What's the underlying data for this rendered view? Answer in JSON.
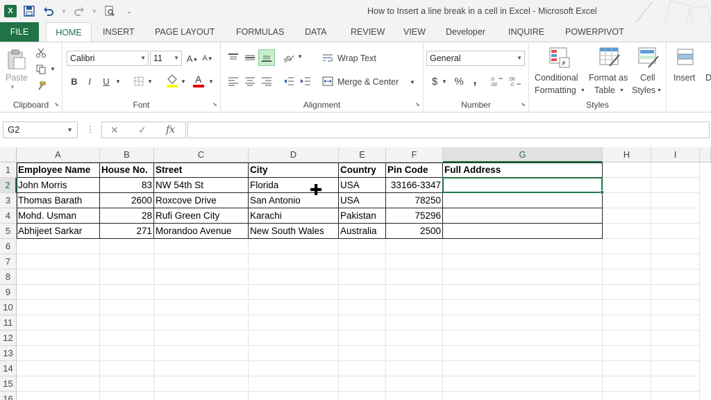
{
  "window": {
    "title": "How to Insert a line break in a cell in Excel - Microsoft Excel",
    "app_icon": "X"
  },
  "qat": {
    "icons": [
      "excel-icon",
      "save-icon",
      "undo-icon",
      "redo-icon",
      "print-preview-icon",
      "customize-icon"
    ]
  },
  "tabs": [
    "FILE",
    "HOME",
    "INSERT",
    "PAGE LAYOUT",
    "FORMULAS",
    "DATA",
    "REVIEW",
    "VIEW",
    "Developer",
    "INQUIRE",
    "POWERPIVOT"
  ],
  "ribbon": {
    "clipboard": {
      "label": "Clipboard",
      "paste": "Paste"
    },
    "font": {
      "label": "Font",
      "name": "Calibri",
      "size": "11",
      "bold": "B",
      "italic": "I",
      "underline": "U"
    },
    "alignment": {
      "label": "Alignment",
      "wrap_text": "Wrap Text",
      "merge_center": "Merge & Center"
    },
    "number": {
      "label": "Number",
      "format": "General",
      "currency": "$",
      "percent": "%",
      "comma": ","
    },
    "styles": {
      "label": "Styles",
      "conditional": "Conditional",
      "conditional2": "Formatting",
      "format_as": "Format as",
      "format_as2": "Table",
      "cell": "Cell",
      "cell2": "Styles"
    },
    "cells": {
      "insert": "Insert",
      "delete": "D"
    }
  },
  "formula_bar": {
    "name_box": "G2",
    "cancel": "✕",
    "enter": "✓",
    "fx": "fx",
    "content": ""
  },
  "sheet": {
    "columns": [
      "A",
      "B",
      "C",
      "D",
      "E",
      "F",
      "G",
      "H",
      "I"
    ],
    "rows": [
      "1",
      "2",
      "3",
      "4",
      "5",
      "6",
      "7",
      "8",
      "9",
      "10",
      "11",
      "12",
      "13",
      "14",
      "15",
      "16"
    ],
    "headers": [
      "Employee Name",
      "House No.",
      "Street",
      "City",
      "Country",
      "Pin Code",
      "Full Address"
    ],
    "data": [
      [
        "John Morris",
        "83",
        "NW 54th St",
        "Florida",
        "USA",
        "33166-3347",
        ""
      ],
      [
        "Thomas Barath",
        "2600",
        "Roxcove Drive",
        "San Antonio",
        "USA",
        "78250",
        ""
      ],
      [
        "Mohd. Usman",
        "28",
        "Rufi Green City",
        "Karachi",
        "Pakistan",
        "75296",
        ""
      ],
      [
        "Abhijeet Sarkar",
        "271",
        "Morandoo Avenue",
        "New South Wales",
        "Australia",
        "2500",
        ""
      ]
    ],
    "active_cell": "G2"
  },
  "colors": {
    "accent": "#217346",
    "file_tab": "#217346"
  }
}
